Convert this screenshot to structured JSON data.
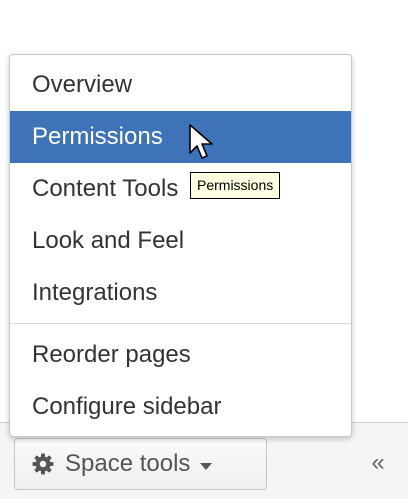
{
  "menu": {
    "items": [
      {
        "label": "Overview"
      },
      {
        "label": "Permissions"
      },
      {
        "label": "Content Tools"
      },
      {
        "label": "Look and Feel"
      },
      {
        "label": "Integrations"
      },
      {
        "label": "Reorder pages"
      },
      {
        "label": "Configure sidebar"
      }
    ],
    "active_index": 1
  },
  "tooltip": {
    "text": "Permissions"
  },
  "toolbar": {
    "space_tools_label": "Space tools",
    "collapse_glyph": "«"
  },
  "icons": {
    "gear": "gear-icon",
    "caret": "caret-down-icon",
    "collapse": "double-chevron-left-icon",
    "cursor": "mouse-pointer-icon"
  },
  "colors": {
    "active_bg": "#3e73b8",
    "tooltip_bg": "#ffffe1",
    "footer_bg": "#f4f5f7"
  }
}
